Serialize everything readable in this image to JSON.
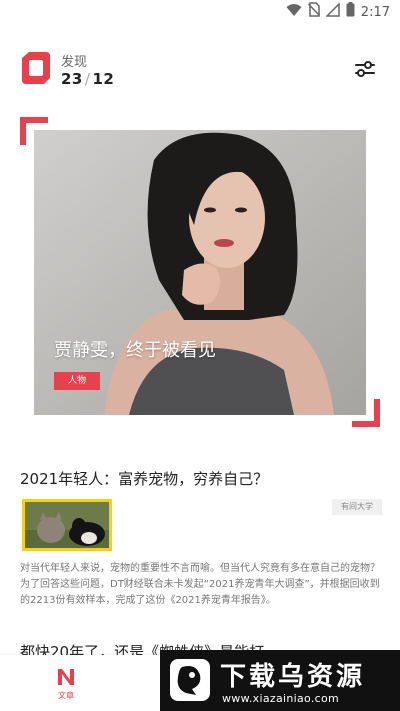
{
  "status_bar": {
    "time": "2:17",
    "icons": [
      "wifi-icon",
      "no-sim-icon",
      "signal-icon",
      "battery-icon"
    ]
  },
  "header": {
    "title": "发现",
    "current": "23",
    "separator": "/",
    "total": "12",
    "logo_icon": "app-logo-icon",
    "filter_icon": "filter-sliders-icon"
  },
  "featured": {
    "title": "贾静雯，终于被看见",
    "tag": "人物",
    "accent_color": "#e8414e"
  },
  "articles": [
    {
      "title": "2021年轻人：富养宠物，穷养自己？",
      "source": "有间大学",
      "summary": "对当代年轻人来说，宠物的重要性不言而喻。但当代人究竟有多在意自己的宠物？为了回答这些问题，DT财经联合未卡发起“2021养宠青年大调查”，并根据回收到的2213份有效样本，完成了这份《2021养宠青年报告》。",
      "thumb_border_color": "#f4d20c"
    },
    {
      "title": "都快20年了，还是《蜘蛛侠》最能打"
    }
  ],
  "bottom_nav": {
    "items": [
      {
        "label": "文章",
        "icon": "article-n-icon",
        "active": true
      }
    ]
  },
  "watermark": {
    "title": "下载乌资源",
    "url": "www.xiazainiao.com"
  }
}
